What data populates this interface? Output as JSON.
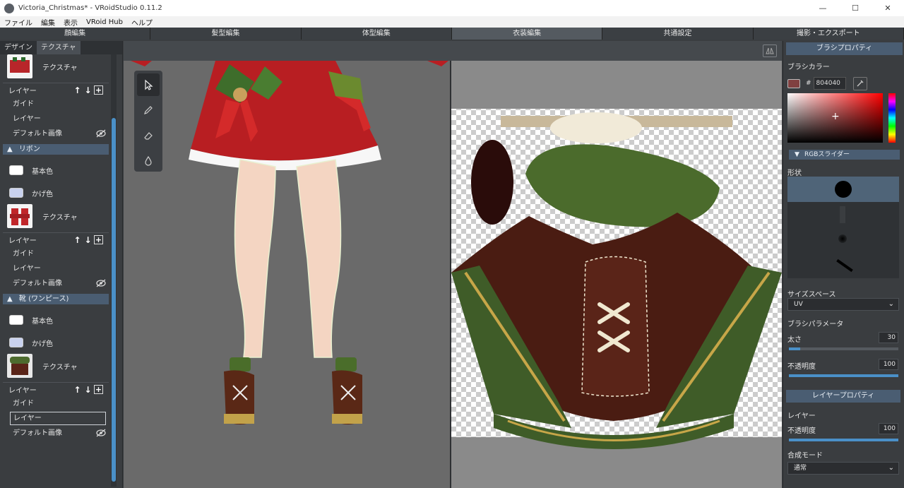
{
  "window": {
    "title": "Victoria_Christmas* - VRoidStudio 0.11.2",
    "minimize": "—",
    "maximize": "☐",
    "close": "✕"
  },
  "menu": [
    "ファイル",
    "編集",
    "表示",
    "VRoid Hub",
    "ヘルプ"
  ],
  "mode_tabs": [
    "顔編集",
    "髪型編集",
    "体型編集",
    "衣装編集",
    "共通設定",
    "撮影・エクスポート"
  ],
  "active_mode_tab": "衣装編集",
  "left_panel": {
    "tabs": [
      "デザイン",
      "テクスチャ"
    ],
    "active_tab": "テクスチャ",
    "top_texture_label": "テクスチャ",
    "top_layer_header": "レイヤー",
    "top_layers": [
      "ガイド",
      "レイヤー",
      "デフォルト画像"
    ],
    "ribbon_section": {
      "title": "リボン",
      "base_color_label": "基本色",
      "shade_color_label": "かげ色",
      "texture_label": "テクスチャ",
      "layer_header": "レイヤー",
      "layers": [
        "ガイド",
        "レイヤー",
        "デフォルト画像"
      ]
    },
    "shoes_section": {
      "title": "靴 (ワンピース)",
      "base_color_label": "基本色",
      "shade_color_label": "かげ色",
      "texture_label": "テクスチャ",
      "layer_header": "レイヤー",
      "layers": [
        "ガイド",
        "レイヤー",
        "デフォルト画像"
      ],
      "selected_layer": "レイヤー"
    },
    "icons": {
      "up": "↑",
      "down": "↓",
      "add": "+",
      "collapse": "▲"
    }
  },
  "tools": [
    "select-tool",
    "pen-tool",
    "eraser-tool",
    "fill-tool"
  ],
  "right_panel": {
    "brush_header": "ブラシプロパティ",
    "brush_color_label": "ブラシカラー",
    "hex_prefix": "#",
    "hex_value": "804040",
    "brush_color": "#804040",
    "rgb_slider_label": "RGBスライダー",
    "shape_label": "形状",
    "size_space_label": "サイズスペース",
    "size_space_value": "UV",
    "brush_params_label": "ブラシパラメータ",
    "thickness_label": "太さ",
    "thickness_value": "30",
    "thickness_fraction": 0.1,
    "opacity_label": "不透明度",
    "opacity_value": "100",
    "opacity_fraction": 1.0,
    "layer_header": "レイヤープロパティ",
    "layer_label": "レイヤー",
    "layer_opacity_label": "不透明度",
    "layer_opacity_value": "100",
    "layer_opacity_fraction": 1.0,
    "blend_mode_label": "合成モード",
    "blend_mode_value": "通常"
  }
}
